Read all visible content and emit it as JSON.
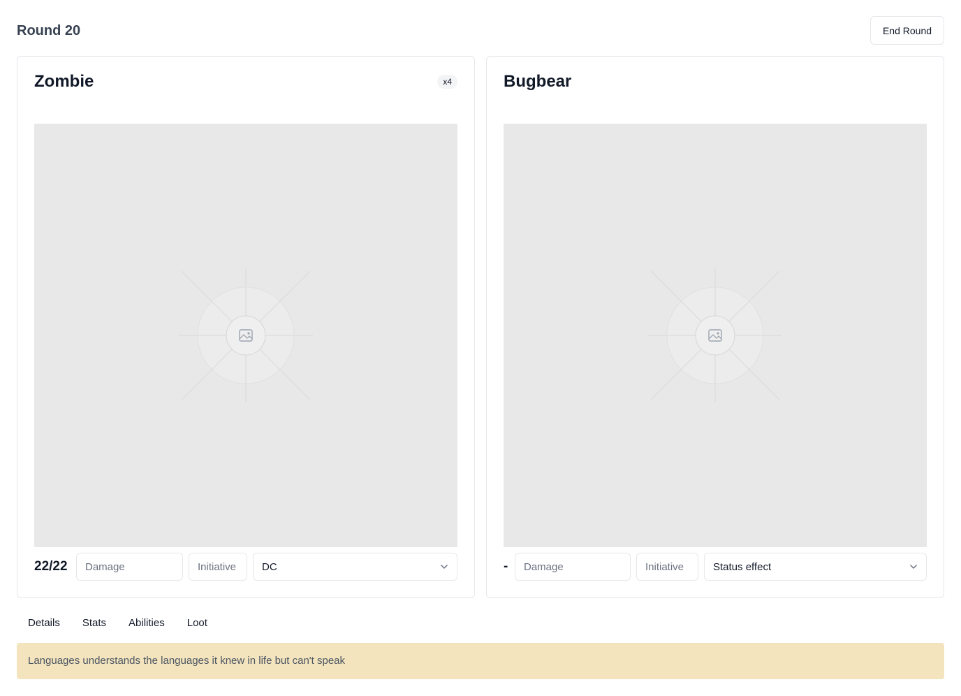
{
  "header": {
    "round_label": "Round 20",
    "end_round_label": "End Round"
  },
  "cards": [
    {
      "name": "Zombie",
      "count_badge": "x4",
      "portrait_icon": "image-placeholder-icon",
      "hp": "22/22",
      "damage_placeholder": "Damage",
      "initiative_placeholder": "Initiative",
      "select_value": "DC"
    },
    {
      "name": "Bugbear",
      "portrait_icon": "image-placeholder-icon",
      "hp": "-",
      "damage_placeholder": "Damage",
      "initiative_placeholder": "Initiative",
      "select_value": "Status effect"
    }
  ],
  "tabs": [
    "Details",
    "Stats",
    "Abilities",
    "Loot"
  ],
  "note": {
    "text": "Languages understands the languages it knew in life but can't speak"
  },
  "colors": {
    "note_bg": "#f3e4bd",
    "portrait_bg": "#e8e8e8",
    "border": "#e5e7eb"
  }
}
